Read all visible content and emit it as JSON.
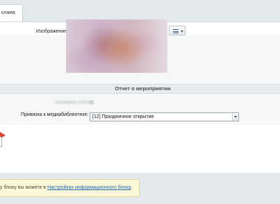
{
  "tabs": [
    {
      "label": "клама"
    }
  ],
  "image_field": {
    "label": "Изображение",
    "menu_icon": "hamburger-menu-icon"
  },
  "section": {
    "title": "Отчет о мероприятии"
  },
  "media_binding": {
    "blurred_label": "Показывать в блоке",
    "label": "Привязка к медиабиблиотеке:",
    "selected_value": "[12] Праздничное открытие"
  },
  "notice": {
    "prefix": "у блоку вы можете в ",
    "link": "Настройках информационного блока",
    "suffix": "."
  },
  "colors": {
    "arrow": "#e0483a",
    "link": "#2067b0",
    "notice_bg": "#fbf7d9"
  }
}
